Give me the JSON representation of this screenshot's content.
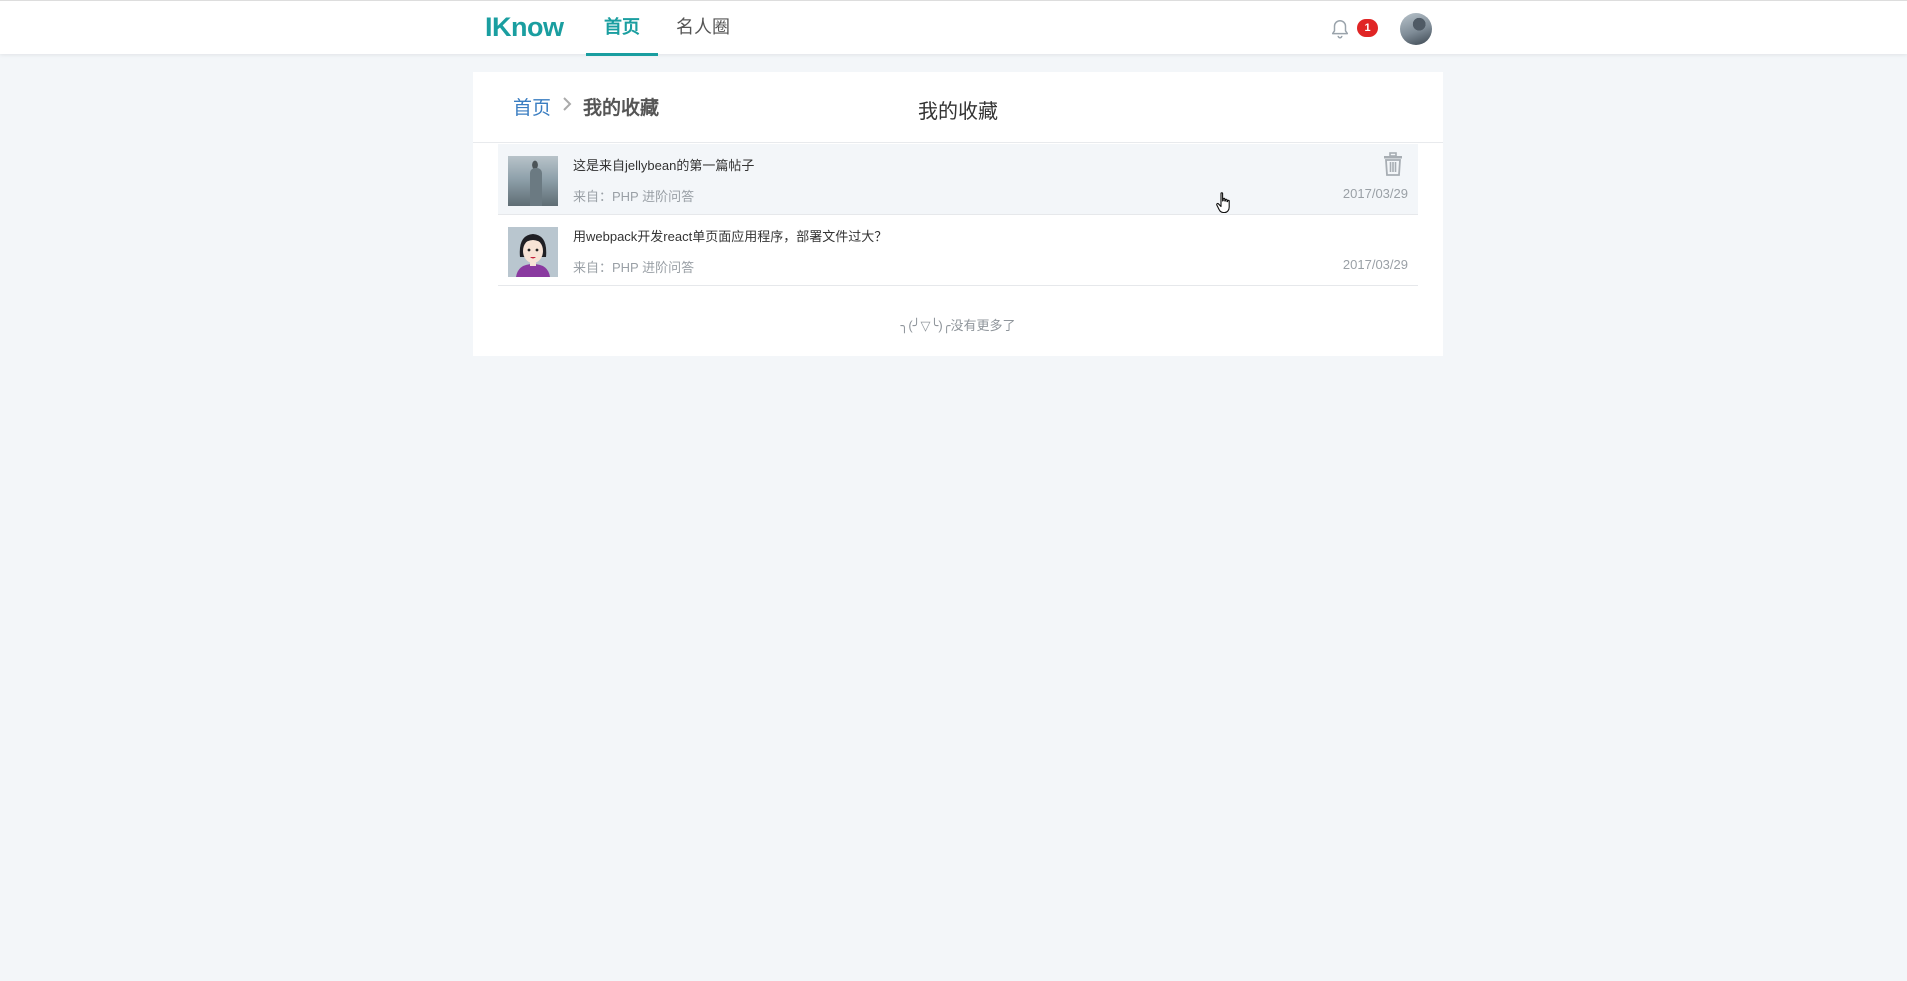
{
  "header": {
    "logo": "IKnow",
    "tabs": [
      {
        "label": "首页",
        "active": true
      },
      {
        "label": "名人圈",
        "active": false
      }
    ],
    "notification_count": "1",
    "accent_color": "#1a9ea0",
    "badge_color": "#e02525"
  },
  "breadcrumb": {
    "home": "首页",
    "current": "我的收藏"
  },
  "page_title": "我的收藏",
  "favorites": [
    {
      "title": "这是来自jellybean的第一篇帖子",
      "source": "来自：PHP 进阶问答",
      "date": "2017/03/29",
      "thumb_icon": "landscape-person-thumbnail"
    },
    {
      "title": "用webpack开发react单页面应用程序，部署文件过大？",
      "source": "来自：PHP 进阶问答",
      "date": "2017/03/29",
      "thumb_icon": "girl-avatar-thumbnail"
    }
  ],
  "no_more_text": "╮(╯▽╰)╭没有更多了"
}
